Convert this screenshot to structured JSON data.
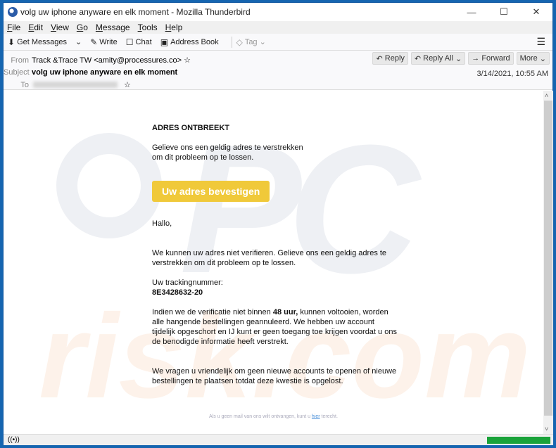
{
  "window": {
    "title": "volg uw iphone anyware en elk moment - Mozilla Thunderbird",
    "controls": {
      "minimize": "—",
      "maximize": "☐",
      "close": "✕"
    }
  },
  "menu": [
    "File",
    "Edit",
    "View",
    "Go",
    "Message",
    "Tools",
    "Help"
  ],
  "toolbar": {
    "get_messages": "Get Messages",
    "write": "Write",
    "chat": "Chat",
    "address_book": "Address Book",
    "tag": "Tag"
  },
  "header": {
    "from_label": "From",
    "from_value": "Track &Trace TW <amity@processures.co>",
    "subject_label": "Subject",
    "subject_value": "volg uw iphone anyware en elk moment",
    "to_label": "To",
    "date": "3/14/2021, 10:55 AM",
    "actions": {
      "reply": "Reply",
      "reply_all": "Reply All",
      "forward": "Forward",
      "more": "More"
    }
  },
  "email": {
    "heading": "ADRES ONTBREEKT",
    "intro": "Gelieve ons een geldig adres te verstrekken om dit probleem op te lossen.",
    "cta": "Uw adres bevestigen",
    "cta_color": "#f0c93a",
    "greeting": "Hallo,",
    "para1": "We kunnen uw adres niet verifieren. Gelieve ons een geldig adres te verstrekken om dit probleem op te lossen.",
    "tracking_label": "Uw trackingnummer:",
    "tracking_number": "8E3428632-20",
    "para2_pre": "Indien we de verificatie niet binnen ",
    "para2_bold": "48 uur,",
    "para2_post": " kunnen voltooien, worden alle hangende bestellingen geannuleerd. We hebben uw account tijdelijk opgeschort en IJ kunt er geen toegang toe krijgen voordat u ons de benodigde informatie heeft verstrekt.",
    "para3": "We vragen u vriendelijk om geen nieuwe accounts te openen of nieuwe bestellingen te plaatsen totdat deze kwestie is opgelost.",
    "footer_pre": "Als u geen mail van ons wilt ontvangen, kunt u ",
    "footer_link": "hier",
    "footer_post": " terecht."
  },
  "status": {
    "progress": 1.0
  }
}
